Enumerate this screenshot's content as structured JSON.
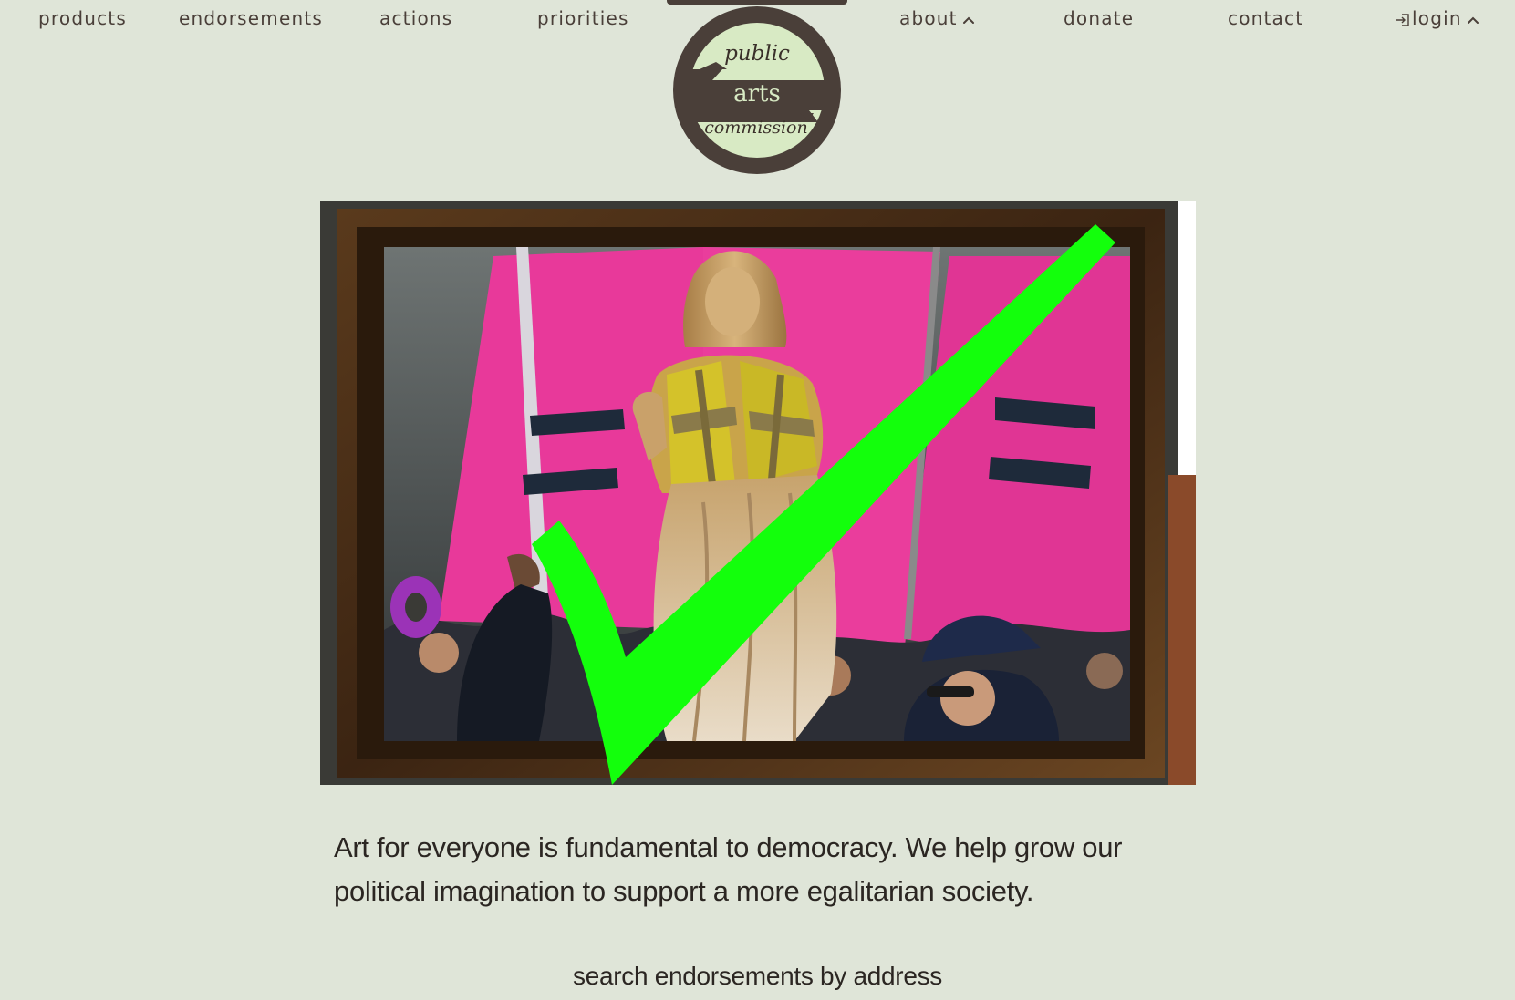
{
  "nav": {
    "products": "products",
    "endorsements": "endorsements",
    "actions": "actions",
    "priorities": "priorities",
    "about": "about",
    "donate": "donate",
    "contact": "contact",
    "login": "login"
  },
  "logo": {
    "line1": "public",
    "line2": "arts",
    "line3": "commission"
  },
  "colors": {
    "background": "#dfe5d8",
    "brand_dark": "#4a3f39",
    "brand_light": "#d8eac4",
    "check_green": "#13ff0c",
    "sign_pink": "#e8399a"
  },
  "hero": {
    "image_description": "statue-in-safety-vest-with-green-checkmark"
  },
  "mission": {
    "text": "Art for everyone is fundamental to democracy. We help grow our political imagination to support a more egalitarian society."
  },
  "search": {
    "heading": "search endorsements by address"
  },
  "icons": {
    "about_chevron": "chevron-up-icon",
    "login_chevron": "chevron-up-icon",
    "login_icon": "login-icon"
  }
}
